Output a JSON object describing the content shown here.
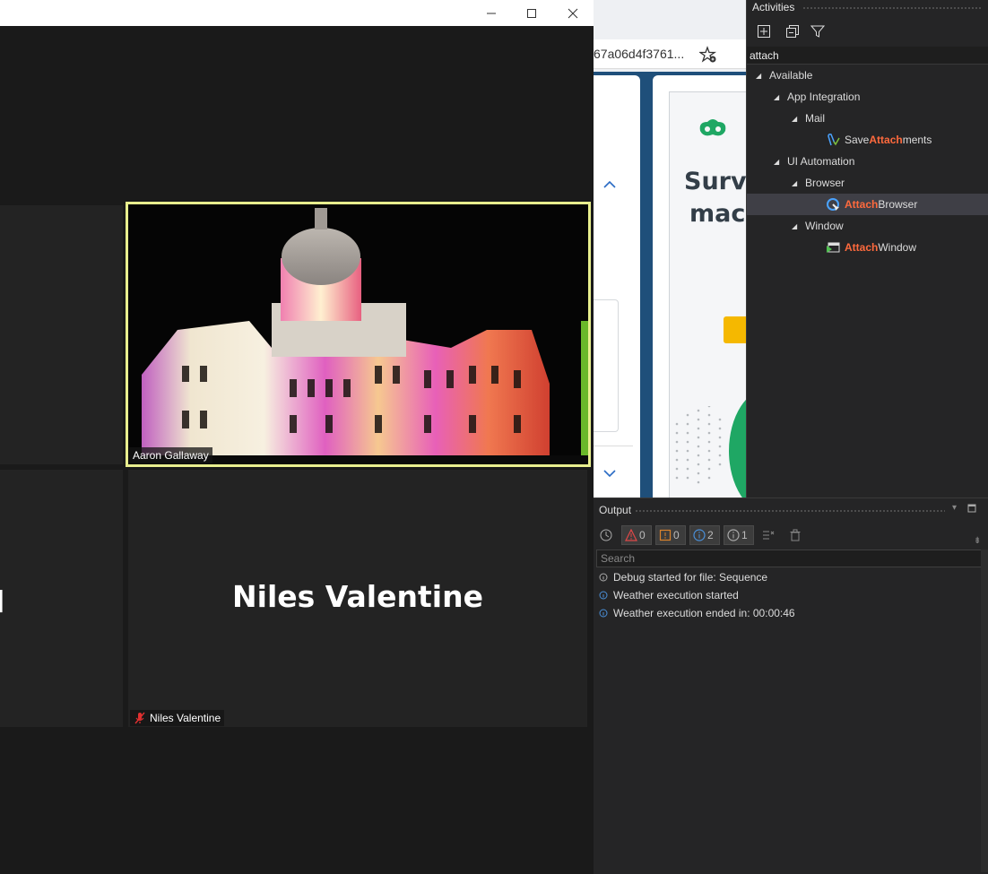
{
  "zoom": {
    "participants": {
      "aaron": {
        "name_tag": "Aaron Gallaway"
      },
      "niles": {
        "display_name": "Niles Valentine",
        "name_tag": "Niles Valentine"
      },
      "cut_left_name": "l"
    },
    "window_controls": {
      "minimize": "–",
      "maximize": "☐",
      "close": "✕"
    }
  },
  "browser": {
    "address_fragment": "67a06d4f3761...",
    "page": {
      "heading_line1": "Surv",
      "heading_line2": "mac"
    }
  },
  "activities": {
    "title": "Activities",
    "search_value": "attach",
    "tree": {
      "available": "Available",
      "app_integration": "App Integration",
      "mail": "Mail",
      "save_attachments": {
        "prefix": "Save ",
        "match": "Attach",
        "suffix": "ments"
      },
      "ui_automation": "UI Automation",
      "browser": "Browser",
      "attach_browser": {
        "match": "Attach",
        "suffix": " Browser"
      },
      "window": "Window",
      "attach_window": {
        "match": "Attach",
        "suffix": " Window"
      }
    }
  },
  "output": {
    "title": "Output",
    "filters": {
      "errors": "0",
      "warnings": "0",
      "info": "2",
      "trace": "1"
    },
    "search_placeholder": "Search",
    "logs": [
      {
        "text": "Debug started for file: Sequence",
        "level": "trace"
      },
      {
        "text": "Weather execution started",
        "level": "info"
      },
      {
        "text": "Weather execution ended in: 00:00:46",
        "level": "info"
      }
    ]
  },
  "colors": {
    "active_speaker_border": "#e8ee8e",
    "highlight": "#ff6a3d",
    "panel_bg": "#252526"
  }
}
